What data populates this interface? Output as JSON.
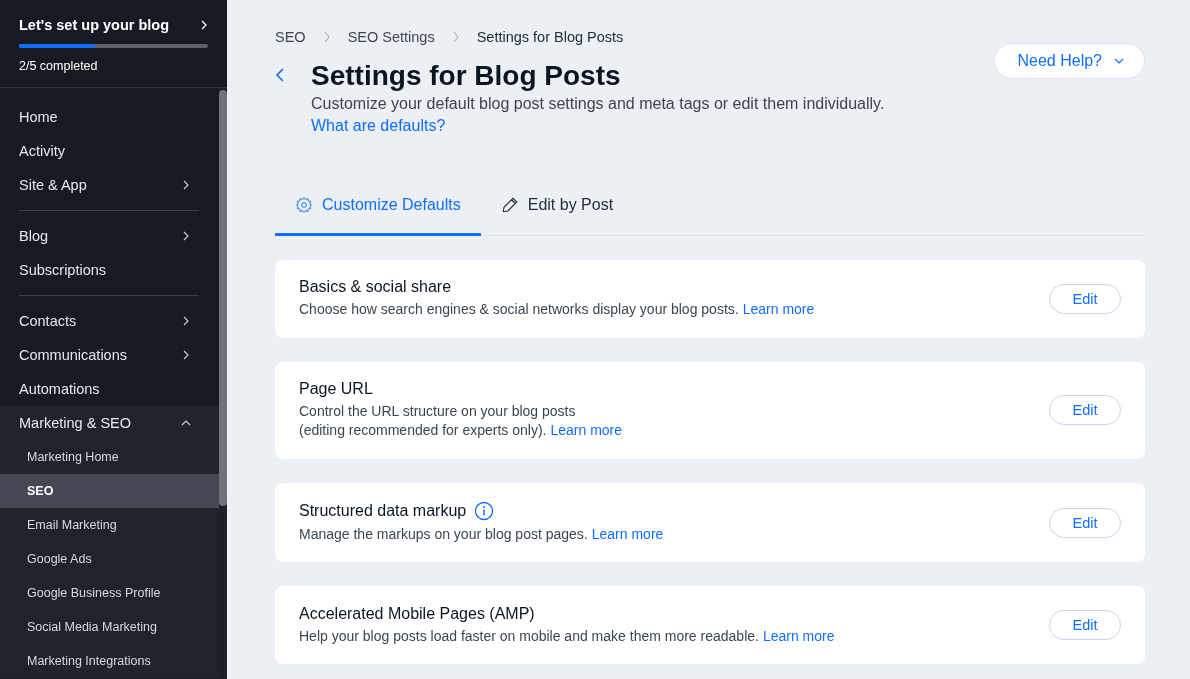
{
  "setup": {
    "title": "Let's set up your blog",
    "level": 0.4,
    "progress_text": "2/5 completed"
  },
  "sidebar": {
    "groups": [
      {
        "items": [
          {
            "label": "Home",
            "kind": "link"
          },
          {
            "label": "Activity",
            "kind": "link"
          },
          {
            "label": "Site & App",
            "kind": "menu",
            "expanded": false
          }
        ]
      },
      {
        "items": [
          {
            "label": "Blog",
            "kind": "menu",
            "expanded": false
          },
          {
            "label": "Subscriptions",
            "kind": "link"
          }
        ]
      },
      {
        "items": [
          {
            "label": "Contacts",
            "kind": "menu",
            "expanded": false
          },
          {
            "label": "Communications",
            "kind": "menu",
            "expanded": false
          },
          {
            "label": "Automations",
            "kind": "link"
          },
          {
            "label": "Marketing & SEO",
            "kind": "menu",
            "expanded": true,
            "children": [
              {
                "label": "Marketing Home",
                "selected": false
              },
              {
                "label": "SEO",
                "selected": true
              },
              {
                "label": "Email Marketing",
                "selected": false
              },
              {
                "label": "Google Ads",
                "selected": false
              },
              {
                "label": "Google Business Profile",
                "selected": false
              },
              {
                "label": "Social Media Marketing",
                "selected": false
              },
              {
                "label": "Marketing Integrations",
                "selected": false
              }
            ]
          }
        ]
      }
    ]
  },
  "breadcrumb": [
    "SEO",
    "SEO Settings",
    "Settings for Blog Posts"
  ],
  "page": {
    "title": "Settings for Blog Posts",
    "subtitle": "Customize your default blog post settings and meta tags or edit them individually.",
    "link": "What are defaults?",
    "help_button": "Need Help?"
  },
  "tabs": [
    {
      "label": "Customize Defaults",
      "kind": "settings",
      "selected": true
    },
    {
      "label": "Edit by Post",
      "kind": "edit",
      "selected": false
    }
  ],
  "cards": [
    {
      "title": "Basics & social share",
      "info": false,
      "description": [
        "Choose how search engines & social networks display your blog posts."
      ],
      "link": "Learn more",
      "button": "Edit"
    },
    {
      "title": "Page URL",
      "info": false,
      "description": [
        "Control the URL structure on your blog posts",
        "(editing recommended for experts only)."
      ],
      "link": "Learn more",
      "button": "Edit"
    },
    {
      "title": "Structured data markup",
      "info": true,
      "description": [
        "Manage the markups on your blog post pages."
      ],
      "link": "Learn more",
      "button": "Edit"
    },
    {
      "title": "Accelerated Mobile Pages (AMP)",
      "info": false,
      "description": [
        "Help your blog posts load faster on mobile and make them more readable."
      ],
      "link": "Learn more",
      "button": "Edit"
    }
  ]
}
